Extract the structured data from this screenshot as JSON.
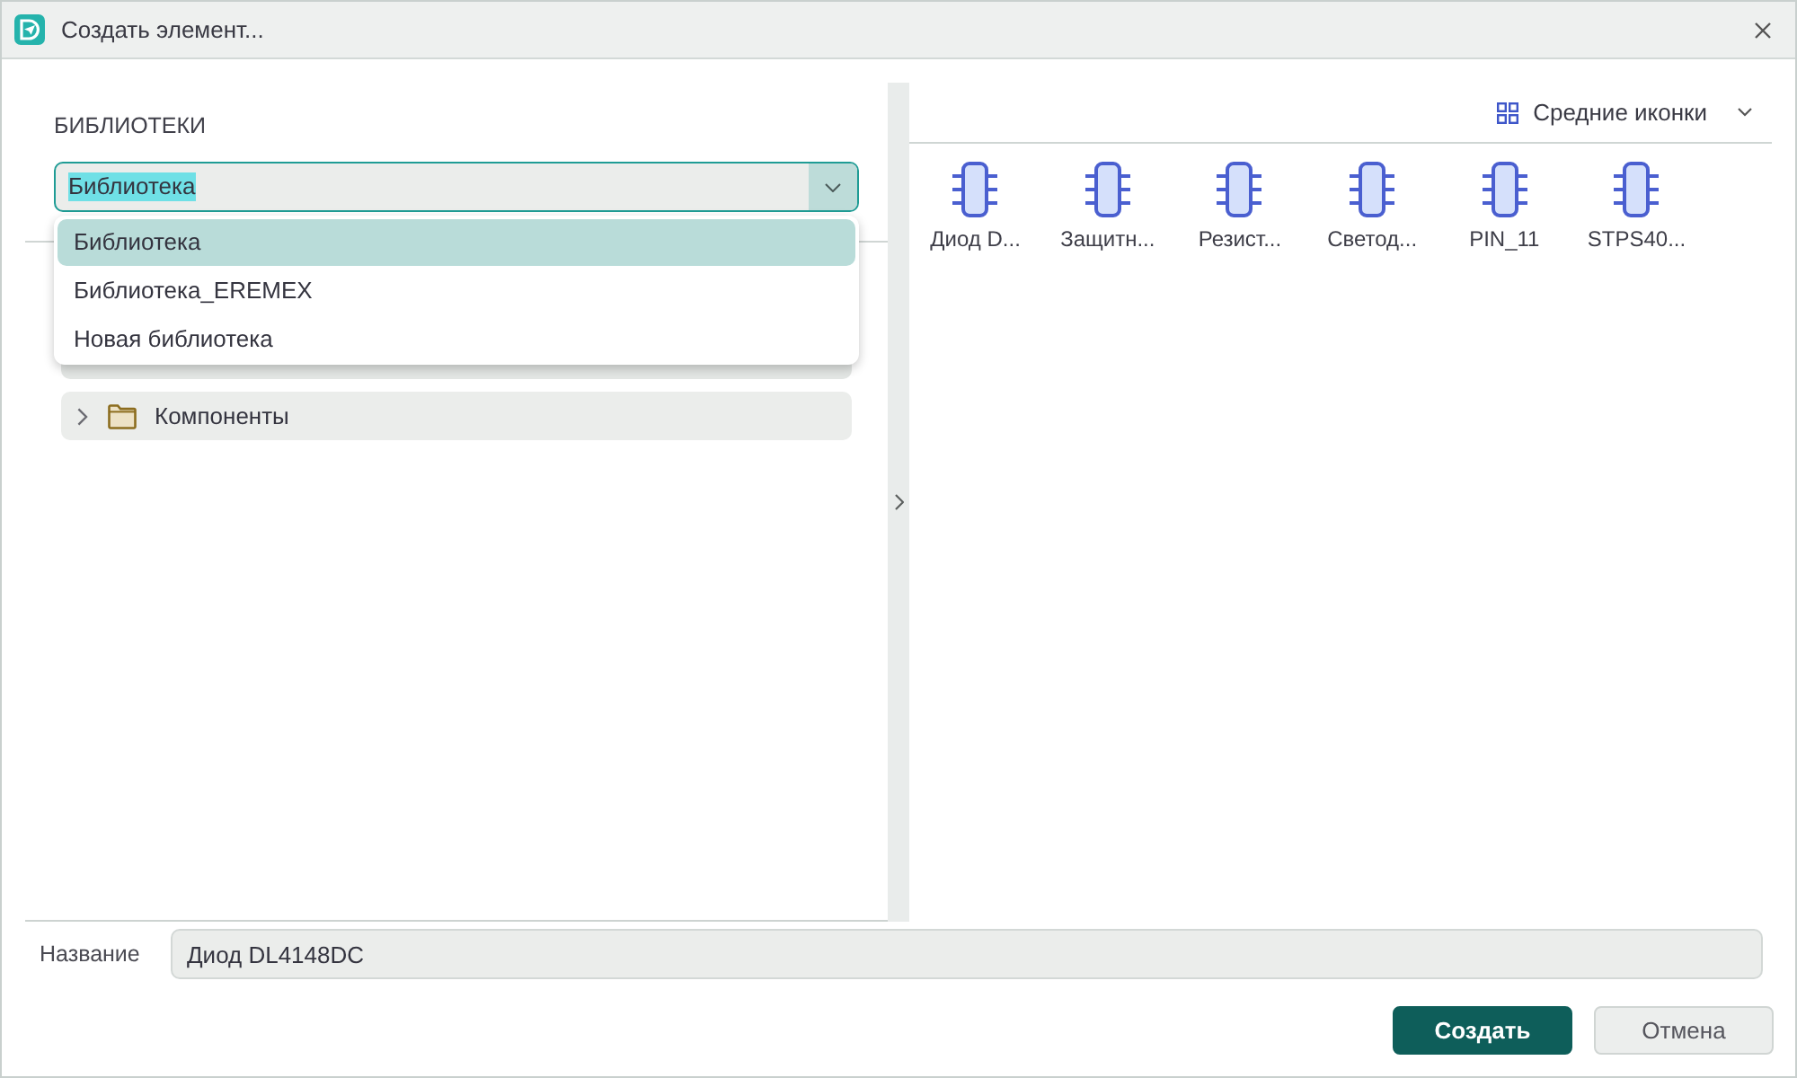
{
  "window": {
    "title": "Создать элемент..."
  },
  "libraries": {
    "heading": "БИБЛИОТЕКИ",
    "selector": {
      "value": "Библиотека",
      "text_highlighted": true,
      "expanded": true,
      "options": [
        {
          "label": "Библиотека",
          "selected": true
        },
        {
          "label": "Библиотека_EREMEX",
          "selected": false
        },
        {
          "label": "Новая библиотека",
          "selected": false
        }
      ]
    },
    "tree": [
      {
        "label": "Компоненты",
        "expanded": false
      }
    ]
  },
  "elements": {
    "view_mode": "Средние иконки",
    "items": [
      {
        "label": "Диод D..."
      },
      {
        "label": "Защитн..."
      },
      {
        "label": "Резист..."
      },
      {
        "label": "Светод..."
      },
      {
        "label": "PIN_11"
      },
      {
        "label": "STPS40..."
      }
    ]
  },
  "name_field": {
    "label": "Название",
    "value": "Диод DL4148DC"
  },
  "buttons": [
    {
      "label": "Создать",
      "kind": "primary"
    },
    {
      "label": "Отмена",
      "kind": "secondary"
    }
  ]
}
